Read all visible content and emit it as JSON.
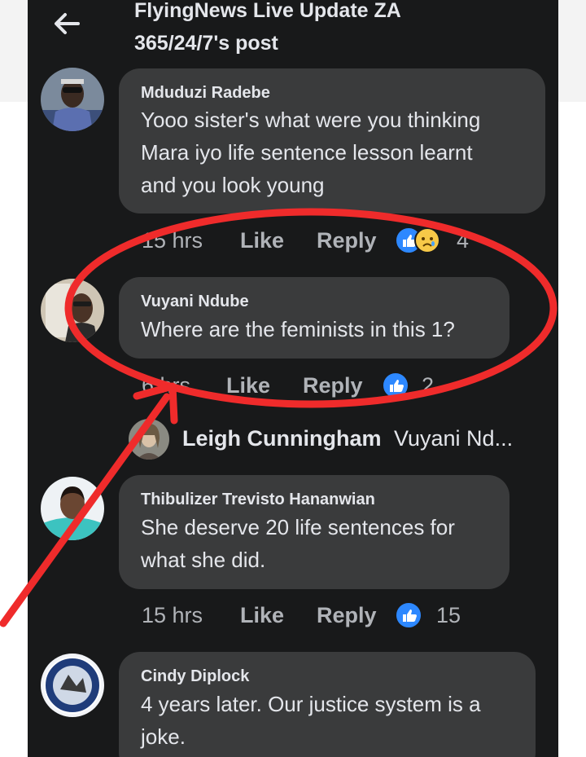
{
  "header": {
    "title": "FlyingNews Live Update ZA",
    "subtitle": "365/24/7's post",
    "back_icon": "arrow-left-icon"
  },
  "comments": [
    {
      "author": "Mduduzi Radebe",
      "lines": [
        "Yooo sister's what were you thinking",
        "Mara iyo life sentence lesson learnt",
        "and you look young"
      ],
      "time": "15 hrs",
      "like": "Like",
      "reply": "Reply",
      "reactions": [
        "like-reaction-icon",
        "sad-reaction-icon"
      ],
      "count": "4"
    },
    {
      "author": "Vuyani Ndube",
      "lines": [
        "Where are the feminists in this 1?"
      ],
      "time": "6 hrs",
      "like": "Like",
      "reply": "Reply",
      "reactions": [
        "like-reaction-icon"
      ],
      "count": "2"
    },
    {
      "author": "Thibulizer Trevisto Hananwian",
      "lines": [
        "She deserve 20 life sentences for",
        "what she did."
      ],
      "time": "15 hrs",
      "like": "Like",
      "reply": "Reply",
      "reactions": [
        "like-reaction-icon"
      ],
      "count": "15"
    },
    {
      "author": "Cindy Diplock",
      "lines": [
        "4 years later. Our justice system is a",
        "joke."
      ]
    }
  ],
  "reply_preview": {
    "author": "Leigh Cunningham",
    "snippet": "Vuyani Nd..."
  },
  "colors": {
    "background": "#18191a",
    "bubble": "#3a3b3c",
    "text": "#e4e6eb",
    "meta": "#b0b3b8",
    "like_blue": "#2d88ff",
    "annotation_red": "#ef2b2b"
  }
}
